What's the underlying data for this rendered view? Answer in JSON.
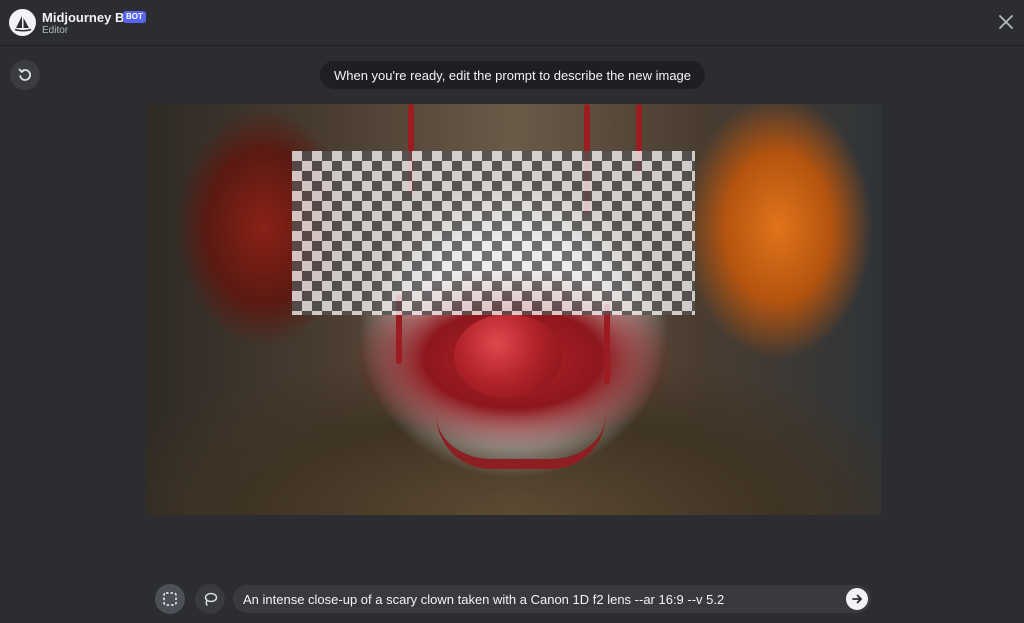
{
  "header": {
    "bot_name": "Midjourney Bot",
    "badge": "BOT",
    "subtitle": "Editor"
  },
  "icons": {
    "avatar": "midjourney-sailboat-icon",
    "close": "close-icon",
    "undo": "undo-icon",
    "rect_select": "rectangle-select-icon",
    "lasso_select": "lasso-select-icon",
    "submit": "arrow-right-icon"
  },
  "editor": {
    "hint": "When you're ready, edit the prompt to describe the new image"
  },
  "prompt": {
    "value": "An intense close-up of a scary clown taken with a Canon 1D f2 lens --ar 16:9 --v 5.2"
  },
  "colors": {
    "background": "#2b2d31",
    "badge": "#5865f2",
    "pill": "#1e1f22",
    "input": "#383a40"
  }
}
